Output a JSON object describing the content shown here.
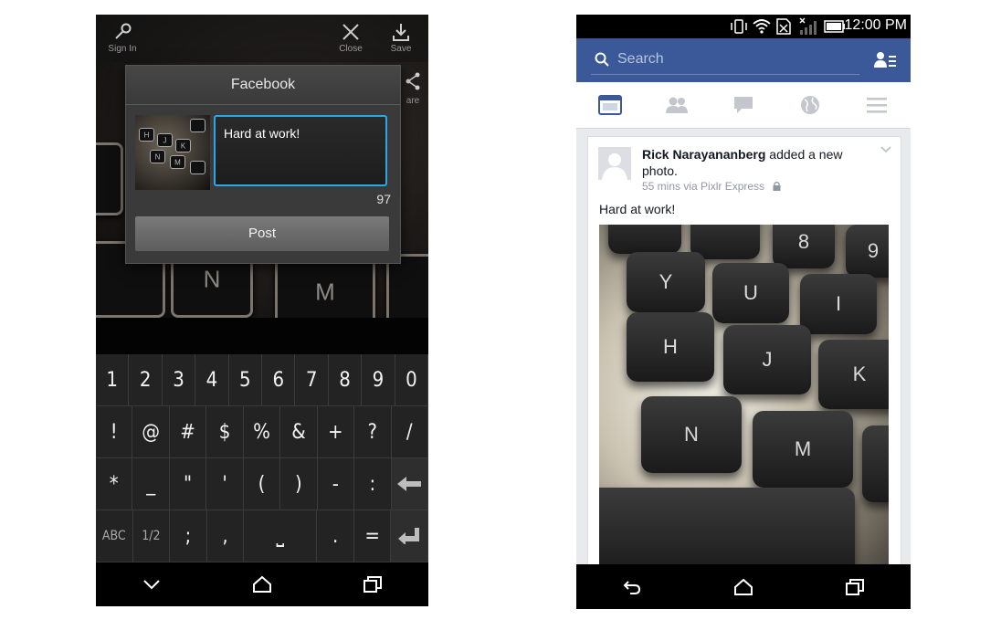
{
  "left": {
    "toolbar": {
      "sign_in": "Sign In",
      "close": "Close",
      "save": "Save",
      "share_partial": "are"
    },
    "dialog": {
      "title": "Facebook",
      "message": "Hard at work!",
      "char_count": "97",
      "post_label": "Post"
    },
    "photo_keys": [
      "N",
      "M"
    ],
    "thumb_keys": [
      "H",
      "J",
      "K",
      "N",
      "M"
    ],
    "keyboard": {
      "row1": [
        "1",
        "2",
        "3",
        "4",
        "5",
        "6",
        "7",
        "8",
        "9",
        "0"
      ],
      "row2": [
        "!",
        "@",
        "#",
        "$",
        "%",
        "&",
        "+",
        "?",
        "/"
      ],
      "row3": [
        "*",
        "_",
        "\"",
        "'",
        "(",
        ")",
        "-",
        ":"
      ],
      "row4": [
        "ABC",
        "1/2",
        ";",
        ",",
        "⎵",
        ".",
        "="
      ]
    }
  },
  "right": {
    "status": {
      "time": "12:00 PM"
    },
    "search": {
      "placeholder": "Search"
    },
    "post": {
      "author": "Rick Narayananberg",
      "action": " added a new photo.",
      "meta": "55 mins via Pixlr Express",
      "caption": "Hard at work!"
    },
    "photo_keys": [
      "Y",
      "U",
      "I",
      "H",
      "J",
      "K",
      "N",
      "M",
      "8",
      "9"
    ]
  }
}
